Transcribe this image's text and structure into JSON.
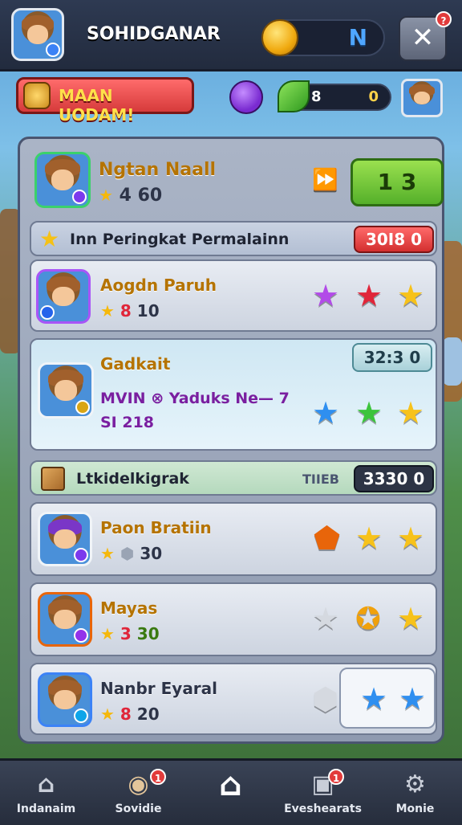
{
  "header": {
    "title": "SOHIDGANAR",
    "currency_label": "N",
    "close_label": "✕",
    "notification_count": "?"
  },
  "subheader": {
    "mission_label": "MAAN UODAM!",
    "resource_value_a": "8",
    "resource_value_b": "0"
  },
  "top_player": {
    "name": "Ngtan Naall",
    "level": "4",
    "score": "60",
    "score_button": "1 3"
  },
  "section_ranking": {
    "title": "Inn Peringkat Permalainn",
    "badge": "30I8 0"
  },
  "rows_a": [
    {
      "name": "Aogdn Paruh",
      "level_icon": "8",
      "score": "10",
      "stars": [
        "#b24be8",
        "#e0263a",
        "#f7c21a"
      ]
    },
    {
      "name": "Gadkait",
      "extra": "MVIN ⊗ Yaduks Ne— 7",
      "detail": "SI 218",
      "badge": "32:3 0",
      "stars": [
        "#2f8ff0",
        "#3cc43c",
        "#f7c21a"
      ]
    }
  ],
  "section_bonus": {
    "title": "Ltkidelkigrak",
    "label": "TIIEB",
    "badge": "3330 0"
  },
  "rows_b": [
    {
      "name": "Paon Bratiin",
      "score": "30"
    },
    {
      "name": "Mayas",
      "level_icon": "3",
      "score": "30"
    },
    {
      "name": "Nanbr Eyaral",
      "level_icon": "8",
      "score": "20"
    }
  ],
  "colors": {
    "accent_green": "#5ab52c",
    "accent_red": "#d63b3b",
    "gold": "#f7c21a"
  },
  "nav": [
    {
      "label": "Indanaim",
      "icon": "home-icon"
    },
    {
      "label": "Sovidie",
      "icon": "pet-icon",
      "badge": "1"
    },
    {
      "label": "",
      "icon": "house-outline-icon"
    },
    {
      "label": "Eveshearats",
      "icon": "box-icon",
      "badge": "1"
    },
    {
      "label": "Monie",
      "icon": "gear-icon"
    }
  ]
}
